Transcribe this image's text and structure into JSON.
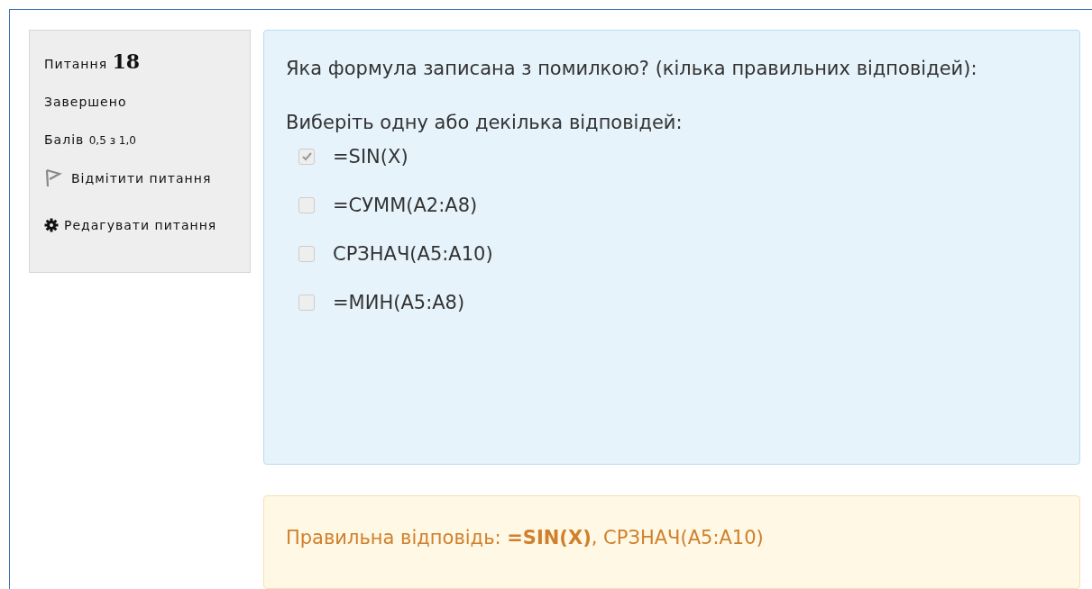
{
  "info": {
    "question_label": "Питання",
    "question_number": "18",
    "status": "Завершено",
    "grade_label": "Балів",
    "grade": "0,5 з 1,0",
    "flag_link": "Відмітити питання",
    "edit_link": "Редагувати питання"
  },
  "question": {
    "text": "Яка формула записана з помилкою? (кілька правильних відповідей):",
    "prompt": "Виберіть одну або декілька відповідей:",
    "options": [
      {
        "label": "=SIN(X)",
        "checked": true
      },
      {
        "label": "=СУММ(А2:А8)",
        "checked": false
      },
      {
        "label": "СРЗНАЧ(А5:А10)",
        "checked": false
      },
      {
        "label": "=МИН(А5:А8)",
        "checked": false
      }
    ]
  },
  "feedback": {
    "text": "Правильна відповідь: **=SIN(X)**, СРЗНАЧ(А5:А10)"
  }
}
